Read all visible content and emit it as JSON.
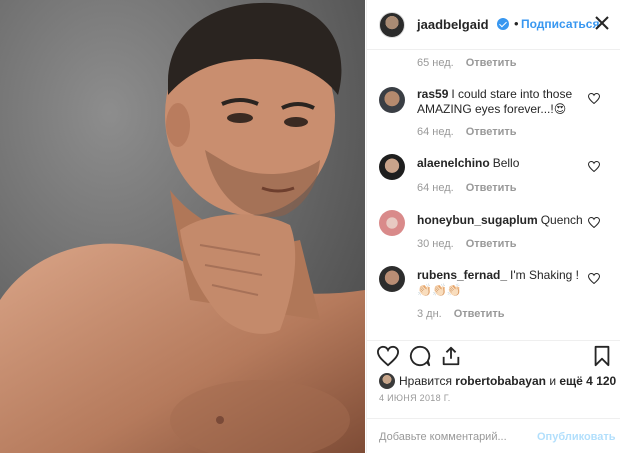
{
  "post": {
    "username": "jaadbelgaid",
    "dot": "•",
    "follow_label": "Подписаться"
  },
  "comments": [
    {
      "meta_time": "65 нед.",
      "reply": "Ответить"
    },
    {
      "username": "ras59",
      "text": "I could stare into those AMAZING eyes forever...!😍",
      "time": "64 нед.",
      "reply": "Ответить"
    },
    {
      "username": "alaenelchino",
      "text": "Bello",
      "time": "64 нед.",
      "reply": "Ответить"
    },
    {
      "username": "honeybun_sugaplum",
      "text": "Quench",
      "time": "30 нед.",
      "reply": "Ответить"
    },
    {
      "username": "rubens_fernad_",
      "text": "I'm Shaking !👏🏻👏🏻👏🏻",
      "time": "3 дн.",
      "reply": "Ответить"
    }
  ],
  "likes": {
    "prefix": "Нравится",
    "user": "robertobabayan",
    "and": "и",
    "count": "ещё 4 120"
  },
  "date": "4 ИЮНЯ 2018 Г.",
  "add_comment": {
    "placeholder": "Добавьте комментарий...",
    "publish": "Опубликовать"
  },
  "colors": {
    "link": "#3897f0",
    "muted": "#999999",
    "publish_disabled": "#b2dffc"
  },
  "icons": [
    "verified-icon",
    "more-icon",
    "heart-icon",
    "comment-icon",
    "share-icon",
    "bookmark-icon"
  ]
}
